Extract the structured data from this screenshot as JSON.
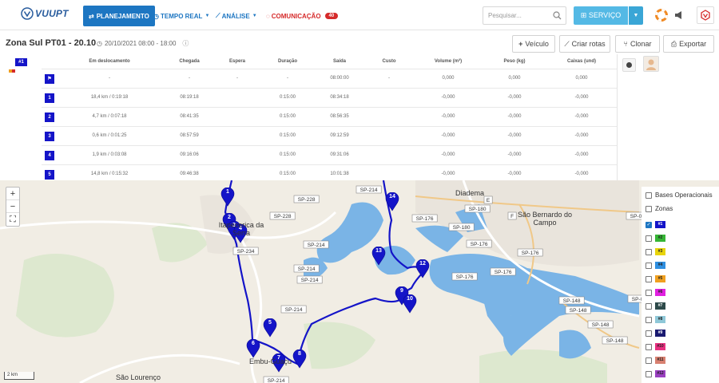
{
  "nav": {
    "logo": "VUUPT",
    "items": [
      {
        "label": "PLANEJAMENTO"
      },
      {
        "label": "TEMPO REAL"
      },
      {
        "label": "ANÁLISE"
      },
      {
        "label": "COMUNICAÇÃO",
        "badge": "40"
      }
    ],
    "search_placeholder": "Pesquisar...",
    "service_label": "SERVIÇO"
  },
  "route": {
    "title": "Zona Sul PT01 - 20.10",
    "date": "20/10/2021 08:00 - 18:00",
    "buttons": {
      "vehicle": "Veículo",
      "create_routes": "Criar rotas",
      "clone": "Clonar",
      "export": "Exportar"
    }
  },
  "table": {
    "vehicle_tag": "#1",
    "headers": [
      "Em deslocamento",
      "Chegada",
      "Espera",
      "Duração",
      "Saída",
      "Custo",
      "Volume (m³)",
      "Peso (kg)",
      "Caixas (und)"
    ],
    "rows": [
      {
        "stop": "⚑",
        "travel": "-",
        "arrival": "-",
        "wait": "-",
        "duration": "-",
        "departure": "08:00:00",
        "cost": "-",
        "volume": "0,000",
        "weight": "0,000",
        "boxes": "0,000"
      },
      {
        "stop": "1",
        "travel": "18,4 km / 0:19:18",
        "arrival": "08:19:18",
        "wait": "",
        "duration": "0:15:00",
        "departure": "08:34:18",
        "cost": "",
        "volume": "-0,000",
        "weight": "-0,000",
        "boxes": "-0,000"
      },
      {
        "stop": "2",
        "travel": "4,7 km / 0:07:18",
        "arrival": "08:41:35",
        "wait": "",
        "duration": "0:15:00",
        "departure": "08:56:35",
        "cost": "",
        "volume": "-0,000",
        "weight": "-0,000",
        "boxes": "-0,000"
      },
      {
        "stop": "3",
        "travel": "0,6 km / 0:01:25",
        "arrival": "08:57:59",
        "wait": "",
        "duration": "0:15:00",
        "departure": "09:12:59",
        "cost": "",
        "volume": "-0,000",
        "weight": "-0,000",
        "boxes": "-0,000"
      },
      {
        "stop": "4",
        "travel": "1,9 km / 0:03:08",
        "arrival": "09:16:06",
        "wait": "",
        "duration": "0:15:00",
        "departure": "09:31:06",
        "cost": "",
        "volume": "-0,000",
        "weight": "-0,000",
        "boxes": "-0,000"
      },
      {
        "stop": "5",
        "travel": "14,8 km / 0:15:32",
        "arrival": "09:46:38",
        "wait": "",
        "duration": "0:15:00",
        "departure": "10:01:38",
        "cost": "",
        "volume": "-0,000",
        "weight": "-0,000",
        "boxes": "-0,000"
      }
    ]
  },
  "map": {
    "towns": [
      "Diadema",
      "São Bernardo do Campo",
      "Itapecerica da Serra",
      "Embu-Guaçu",
      "São Lourenço"
    ],
    "road_labels": [
      "SP-228",
      "SP-228",
      "SP-214",
      "SP-214",
      "SP-214",
      "SP-214",
      "SP-234",
      "SP-214",
      "SP-214",
      "SP-176",
      "SP-180",
      "SP-180",
      "SP-176",
      "SP-176",
      "SP-176",
      "SP-176",
      "SP-148",
      "SP-148",
      "SP-148",
      "SP-148",
      "SP-031",
      "SP-017",
      "E",
      "F"
    ],
    "markers": [
      "1",
      "2",
      "3",
      "4",
      "5",
      "6",
      "7",
      "8",
      "9",
      "10",
      "12",
      "13",
      "14"
    ],
    "scale": "2 km",
    "zoom_in": "+",
    "zoom_out": "−"
  },
  "layers": {
    "items": [
      {
        "label": "Bases Operacionais",
        "checked": false
      },
      {
        "label": "Zonas",
        "checked": false
      }
    ],
    "vehicles": [
      {
        "label": "#1",
        "color": "#1414c8",
        "checked": true
      },
      {
        "label": "#2",
        "color": "#35b535",
        "checked": false
      },
      {
        "label": "#3",
        "color": "#e8d40a",
        "checked": false
      },
      {
        "label": "#4",
        "color": "#2f8fe0",
        "checked": false
      },
      {
        "label": "#5",
        "color": "#f0a020",
        "checked": false
      },
      {
        "label": "#6",
        "color": "#e020e0",
        "checked": false
      },
      {
        "label": "#7",
        "color": "#2e4a4a",
        "checked": false
      },
      {
        "label": "#8",
        "color": "#8fc8d8",
        "checked": false
      },
      {
        "label": "#9",
        "color": "#1a1a70",
        "checked": false
      },
      {
        "label": "#10",
        "color": "#e83080",
        "checked": false
      },
      {
        "label": "#11",
        "color": "#d88070",
        "checked": false
      },
      {
        "label": "#12",
        "color": "#9a40c0",
        "checked": false
      },
      {
        "label": "#13",
        "color": "#5a1a1a",
        "checked": false
      }
    ]
  },
  "colors": {
    "primary": "#1d76c2",
    "route": "#1414c8",
    "water": "#7ab4e6",
    "service": "#54b9e5",
    "alert": "#d52a2a"
  }
}
